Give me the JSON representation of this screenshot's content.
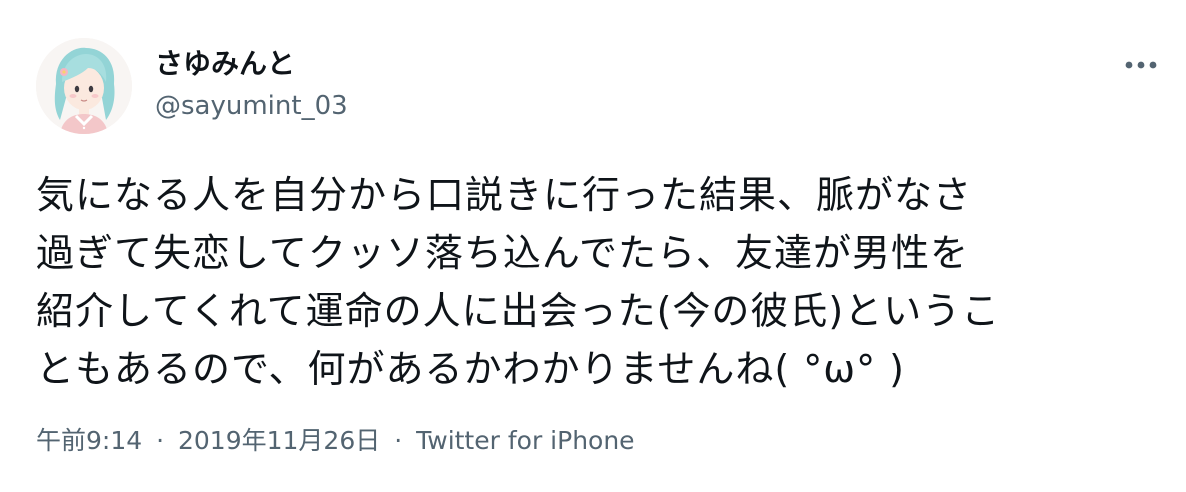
{
  "author": {
    "display_name": "さゆみんと",
    "handle": "@sayumint_03"
  },
  "menu": {
    "icon": "more-horizontal-icon"
  },
  "tweet": {
    "lines": [
      "気になる人を自分から口説きに行った結果、脈がなさ",
      "過ぎて失恋してクッソ落ち込んでたら、友達が男性を",
      "紹介してくれて運命の人に出会った(今の彼氏)というこ",
      "ともあるので、何があるかわかりませんね( °ω° )"
    ]
  },
  "meta": {
    "time": "午前9:14",
    "separator": "·",
    "date": "2019年11月26日",
    "source": "Twitter for iPhone"
  },
  "colors": {
    "text_primary": "#0f1419",
    "text_secondary": "#536471",
    "avatar_hair": "#8fd3d6"
  }
}
